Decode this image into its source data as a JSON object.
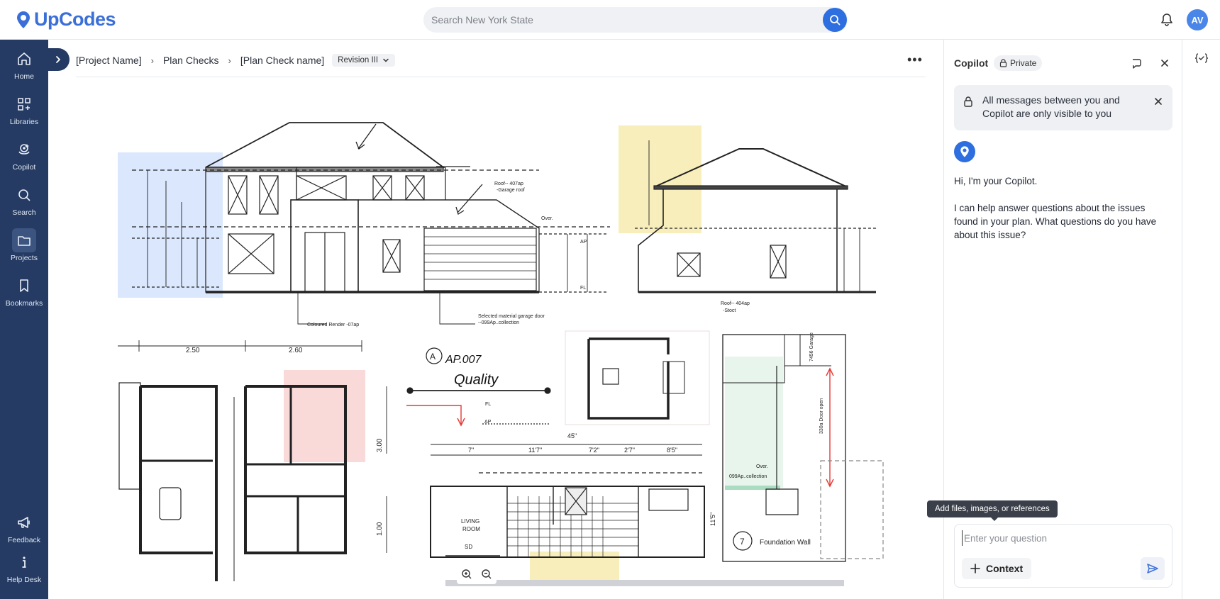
{
  "app": {
    "name": "UpCodes",
    "brand_color": "#3b6fd8"
  },
  "search": {
    "placeholder": "Search New York State"
  },
  "user": {
    "initials": "AV"
  },
  "sidebar": {
    "items": [
      {
        "label": "Home",
        "icon": "home-icon"
      },
      {
        "label": "Libraries",
        "icon": "libraries-icon"
      },
      {
        "label": "Copilot",
        "icon": "copilot-icon"
      },
      {
        "label": "Search",
        "icon": "search-icon"
      },
      {
        "label": "Projects",
        "icon": "folder-icon",
        "active": true
      },
      {
        "label": "Bookmarks",
        "icon": "bookmark-icon"
      }
    ],
    "bottom": [
      {
        "label": "Feedback",
        "icon": "megaphone-icon"
      },
      {
        "label": "Help Desk",
        "icon": "info-icon"
      }
    ]
  },
  "breadcrumb": {
    "project": "[Project Name]",
    "section": "Plan Checks",
    "plan_check": "[Plan Check name]",
    "revision": "Revision III"
  },
  "drawing": {
    "labels": {
      "roof_a": "Roof-- 407ap",
      "roof_a2": "-Garage roof",
      "over": "Over.",
      "coloured_render": "Coloured Render -07ap",
      "garage_door": "Selected material garage door",
      "garage_door2": "--099Ap..collection",
      "roof_b": "Roof-- 404ap",
      "roof_b2": "-Stoct",
      "dim_250": "2.50",
      "dim_260": "2.60",
      "dim_300": "3.00",
      "dim_100": "1.00",
      "note": "AP.007",
      "quality": "Quality",
      "fl": "FL",
      "ap": "AP",
      "dim_45": "45\"",
      "dim_7": "7\"",
      "dim_117": "11'7\"",
      "dim_72": "7'2\"",
      "dim_27": "2'7\"",
      "dim_85": "8'5\"",
      "dim_115": "11'5\"",
      "living": "LIVING",
      "room": "ROOM",
      "sd": "SD",
      "over2": "Over.",
      "collection": "099Ap..collection",
      "door_open": "330a Door open",
      "garage_7456": "7456 Garage",
      "detail_no": "7",
      "foundation": "Foundation Wall"
    }
  },
  "copilot": {
    "title": "Copilot",
    "privacy_badge": "Private",
    "notice": "All messages between you and Copilot are only visible to you",
    "greeting": "Hi, I'm your Copilot.",
    "intro": "I can help answer questions about the issues found in your plan. What questions do you have about this issue?",
    "tooltip": "Add files, images, or references",
    "input_placeholder": "Enter your question",
    "context_label": "Context"
  }
}
